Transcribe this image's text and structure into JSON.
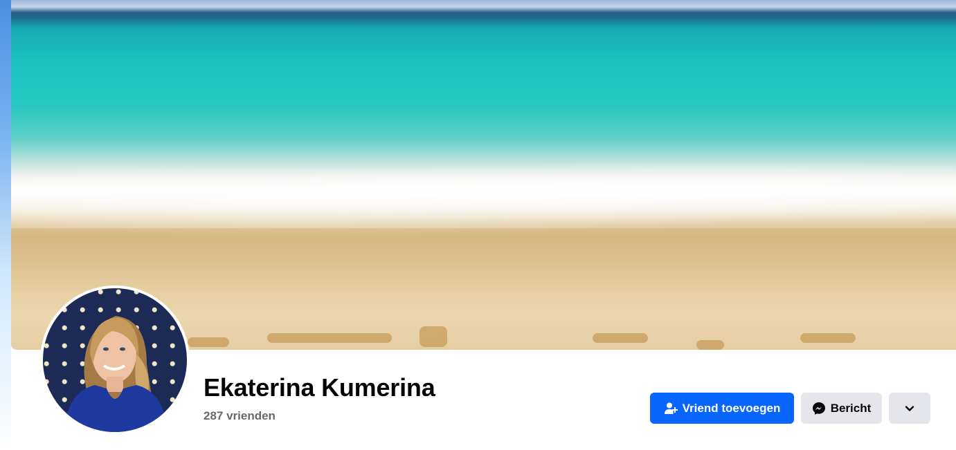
{
  "profile": {
    "name": "Ekaterina Kumerina",
    "friends_count": "287 vrienden"
  },
  "actions": {
    "add_friend_label": "Vriend toevoegen",
    "message_label": "Bericht"
  },
  "icons": {
    "add_friend": "user-plus-icon",
    "message": "messenger-icon",
    "more": "chevron-down-icon"
  },
  "colors": {
    "primary_button": "#0866ff",
    "secondary_button": "#e4e6eb",
    "name_text": "#050505",
    "muted_text": "#65676b"
  }
}
